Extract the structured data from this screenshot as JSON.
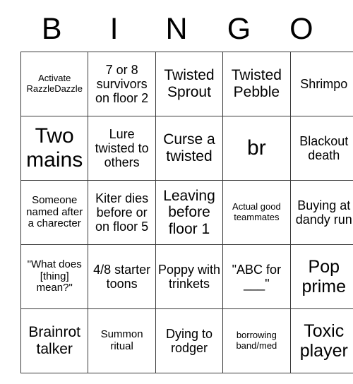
{
  "title": "BINGO",
  "header": {
    "letters": [
      "B",
      "I",
      "N",
      "G",
      "O"
    ]
  },
  "grid": {
    "rows": 5,
    "columns": 5,
    "border_color": "#3a3a3a",
    "background_color": "#ffffff",
    "text_color": "#000000",
    "cells": [
      [
        {
          "text": "Activate RazzleDazzle",
          "size": "fs-xs"
        },
        {
          "text": "7 or 8 survivors on floor 2",
          "size": "fs-md"
        },
        {
          "text": "Twisted Sprout",
          "size": "fs-lg"
        },
        {
          "text": "Twisted Pebble",
          "size": "fs-lg"
        },
        {
          "text": "Shrimpo",
          "size": "fs-md"
        }
      ],
      [
        {
          "text": "Two mains",
          "size": "fs-xxl"
        },
        {
          "text": "Lure twisted to others",
          "size": "fs-md"
        },
        {
          "text": "Curse a twisted",
          "size": "fs-lg"
        },
        {
          "text": "br",
          "size": "fs-xxl"
        },
        {
          "text": "Blackout death",
          "size": "fs-md"
        }
      ],
      [
        {
          "text": "Someone named after a charecter",
          "size": "fs-sm"
        },
        {
          "text": "Kiter dies before or on floor 5",
          "size": "fs-md"
        },
        {
          "text": "Leaving before floor 1",
          "size": "fs-lg"
        },
        {
          "text": "Actual good teammates",
          "size": "fs-xs"
        },
        {
          "text": "Buying at dandy run",
          "size": "fs-md"
        }
      ],
      [
        {
          "text": "\"What does [thing] mean?\"",
          "size": "fs-sm"
        },
        {
          "text": "4/8 starter toons",
          "size": "fs-md"
        },
        {
          "text": "Poppy with trinkets",
          "size": "fs-md"
        },
        {
          "text": "\"ABC for ___\"",
          "size": "fs-md"
        },
        {
          "text": "Pop prime",
          "size": "fs-xl"
        }
      ],
      [
        {
          "text": "Brainrot talker",
          "size": "fs-lg"
        },
        {
          "text": "Summon ritual",
          "size": "fs-sm"
        },
        {
          "text": "Dying to rodger",
          "size": "fs-md"
        },
        {
          "text": "borrowing band/med",
          "size": "fs-xs"
        },
        {
          "text": "Toxic player",
          "size": "fs-xl"
        }
      ]
    ]
  }
}
